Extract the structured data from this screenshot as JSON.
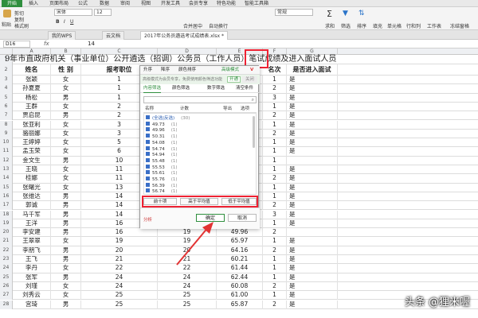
{
  "ribbon": {
    "tabs": [
      "开始",
      "插入",
      "页面布局",
      "公式",
      "数据",
      "审阅",
      "视图",
      "开发工具",
      "会员专享",
      "特色功能",
      "智能工具箱"
    ],
    "active_tab": "开始",
    "cell_ref": "特色功能",
    "buttons": {
      "cut": "剪切",
      "paste": "粘贴",
      "copy": "复制",
      "format_painter": "格式刷",
      "font": "宋体",
      "size": "12",
      "merge": "合并居中",
      "wrap": "自动换行",
      "format": "常规",
      "sum": "求和",
      "filter": "筛选",
      "sort": "排序",
      "fill": "填充",
      "cell": "单元格",
      "row_col": "行和列",
      "worksheet": "工作表",
      "freeze": "冻结窗格",
      "table_tools": "表格工具",
      "find": "查找",
      "symbol": "符号"
    },
    "accent": "#2f8f3e"
  },
  "doc_tabs": [
    {
      "label": "我的WPS"
    },
    {
      "label": "云文档"
    },
    {
      "label": "2017年公务员遴选考试成绩表.xlsx *"
    }
  ],
  "formula_bar": {
    "name_box": "D16",
    "fx": "fx",
    "value": "14"
  },
  "columns": [
    "A",
    "B",
    "C",
    "D",
    "E",
    "F",
    "G"
  ],
  "title": "9年市直政府机关（事业单位）公开遴选（招调）公务员（工作人员）笔试成绩及进入面试人员",
  "header": {
    "name": "姓名",
    "gender": "性 别",
    "position": "报考职位",
    "rank": "名次",
    "interview": "是否进入面试"
  },
  "rows": [
    {
      "num": "3",
      "name": "张颖",
      "gender": "女",
      "pos": "1",
      "d": "",
      "e": "",
      "rank": "1",
      "iv": "是"
    },
    {
      "num": "4",
      "name": "孙夏夏",
      "gender": "女",
      "pos": "1",
      "d": "",
      "e": "",
      "rank": "2",
      "iv": "是"
    },
    {
      "num": "5",
      "name": "杨松",
      "gender": "男",
      "pos": "1",
      "d": "",
      "e": "",
      "rank": "3",
      "iv": "是"
    },
    {
      "num": "6",
      "name": "王群",
      "gender": "女",
      "pos": "2",
      "d": "",
      "e": "",
      "rank": "1",
      "iv": "是"
    },
    {
      "num": "7",
      "name": "贾启昆",
      "gender": "男",
      "pos": "2",
      "d": "",
      "e": "",
      "rank": "2",
      "iv": "是"
    },
    {
      "num": "8",
      "name": "张亚利",
      "gender": "女",
      "pos": "3",
      "d": "",
      "e": "",
      "rank": "1",
      "iv": "是"
    },
    {
      "num": "9",
      "name": "骆丽娜",
      "gender": "女",
      "pos": "3",
      "d": "",
      "e": "",
      "rank": "2",
      "iv": "是"
    },
    {
      "num": "10",
      "name": "王婷婷",
      "gender": "女",
      "pos": "5",
      "d": "",
      "e": "",
      "rank": "1",
      "iv": "是"
    },
    {
      "num": "11",
      "name": "孟玉荣",
      "gender": "女",
      "pos": "6",
      "d": "",
      "e": "",
      "rank": "1",
      "iv": "是"
    },
    {
      "num": "12",
      "name": "金文生",
      "gender": "男",
      "pos": "10",
      "d": "",
      "e": "",
      "rank": "1",
      "iv": ""
    },
    {
      "num": "13",
      "name": "王晓",
      "gender": "女",
      "pos": "11",
      "d": "",
      "e": "",
      "rank": "1",
      "iv": "是"
    },
    {
      "num": "14",
      "name": "桂娜",
      "gender": "女",
      "pos": "11",
      "d": "",
      "e": "",
      "rank": "2",
      "iv": "是"
    },
    {
      "num": "15",
      "name": "张曙光",
      "gender": "女",
      "pos": "13",
      "d": "",
      "e": "",
      "rank": "1",
      "iv": "是"
    },
    {
      "num": "16",
      "name": "张维达",
      "gender": "男",
      "pos": "14",
      "d": "",
      "e": "",
      "rank": "1",
      "iv": "是"
    },
    {
      "num": "17",
      "name": "郭诚",
      "gender": "男",
      "pos": "14",
      "d": "",
      "e": "",
      "rank": "2",
      "iv": "是"
    },
    {
      "num": "18",
      "name": "马千军",
      "gender": "男",
      "pos": "14",
      "d": "",
      "e": "",
      "rank": "3",
      "iv": "是"
    },
    {
      "num": "19",
      "name": "王洋",
      "gender": "男",
      "pos": "16",
      "d": "",
      "e": "",
      "rank": "1",
      "iv": "是"
    },
    {
      "num": "20",
      "name": "李安建",
      "gender": "男",
      "pos": "16",
      "d": "19",
      "e": "49.96",
      "rank": "2",
      "iv": ""
    },
    {
      "num": "21",
      "name": "王翠翠",
      "gender": "女",
      "pos": "19",
      "d": "19",
      "e": "65.97",
      "rank": "1",
      "iv": "是"
    },
    {
      "num": "22",
      "name": "李朋飞",
      "gender": "男",
      "pos": "20",
      "d": "20",
      "e": "64.16",
      "rank": "2",
      "iv": "是"
    },
    {
      "num": "23",
      "name": "王飞",
      "gender": "男",
      "pos": "21",
      "d": "21",
      "e": "60.21",
      "rank": "1",
      "iv": "是"
    },
    {
      "num": "24",
      "name": "李丹",
      "gender": "女",
      "pos": "22",
      "d": "22",
      "e": "61.44",
      "rank": "1",
      "iv": "是"
    },
    {
      "num": "25",
      "name": "张军",
      "gender": "男",
      "pos": "24",
      "d": "24",
      "e": "62.44",
      "rank": "1",
      "iv": "是"
    },
    {
      "num": "26",
      "name": "刘瑾",
      "gender": "女",
      "pos": "24",
      "d": "24",
      "e": "60.08",
      "rank": "2",
      "iv": "是"
    },
    {
      "num": "27",
      "name": "刘秀云",
      "gender": "女",
      "pos": "25",
      "d": "25",
      "e": "61.00",
      "rank": "1",
      "iv": "是"
    },
    {
      "num": "28",
      "name": "宫琦",
      "gender": "男",
      "pos": "25",
      "d": "25",
      "e": "65.87",
      "rank": "2",
      "iv": "是"
    }
  ],
  "filter_popup": {
    "toolbar": {
      "asc": "升序",
      "desc": "降序",
      "color_sort": "颜色排序",
      "advanced": "高级模式",
      "advanced_badge": "V"
    },
    "banner": {
      "text": "高级模式为会员专享，免费使用颜色筛选功能",
      "link": "开通",
      "close": "关闭"
    },
    "tabs": {
      "content": "内容筛选",
      "color": "颜色筛选",
      "number": "数字筛选",
      "clear": "清空条件"
    },
    "search_placeholder": "",
    "list_header": {
      "name": "名称",
      "count": "计数",
      "export": "导出",
      "options": "选项"
    },
    "items": [
      {
        "label": "(全选|反选)",
        "count": "(30)"
      },
      {
        "label": "49.73",
        "count": "(1)"
      },
      {
        "label": "49.96",
        "count": "(1)"
      },
      {
        "label": "50.31",
        "count": "(1)"
      },
      {
        "label": "54.08",
        "count": "(1)"
      },
      {
        "label": "54.74",
        "count": "(1)"
      },
      {
        "label": "54.94",
        "count": "(1)"
      },
      {
        "label": "55.48",
        "count": "(1)"
      },
      {
        "label": "55.53",
        "count": "(1)"
      },
      {
        "label": "55.61",
        "count": "(1)"
      },
      {
        "label": "55.76",
        "count": "(1)"
      },
      {
        "label": "56.39",
        "count": "(1)"
      },
      {
        "label": "56.74",
        "count": "(1)"
      }
    ],
    "quick": {
      "top10": "前十项",
      "above_avg": "高于平均值",
      "below_avg": "低于平均值"
    },
    "footer": {
      "analyze": "分析",
      "ok": "确定",
      "cancel": "取消"
    }
  },
  "watermark": "头条 @狸米喔",
  "highlight_color": "#e23333"
}
